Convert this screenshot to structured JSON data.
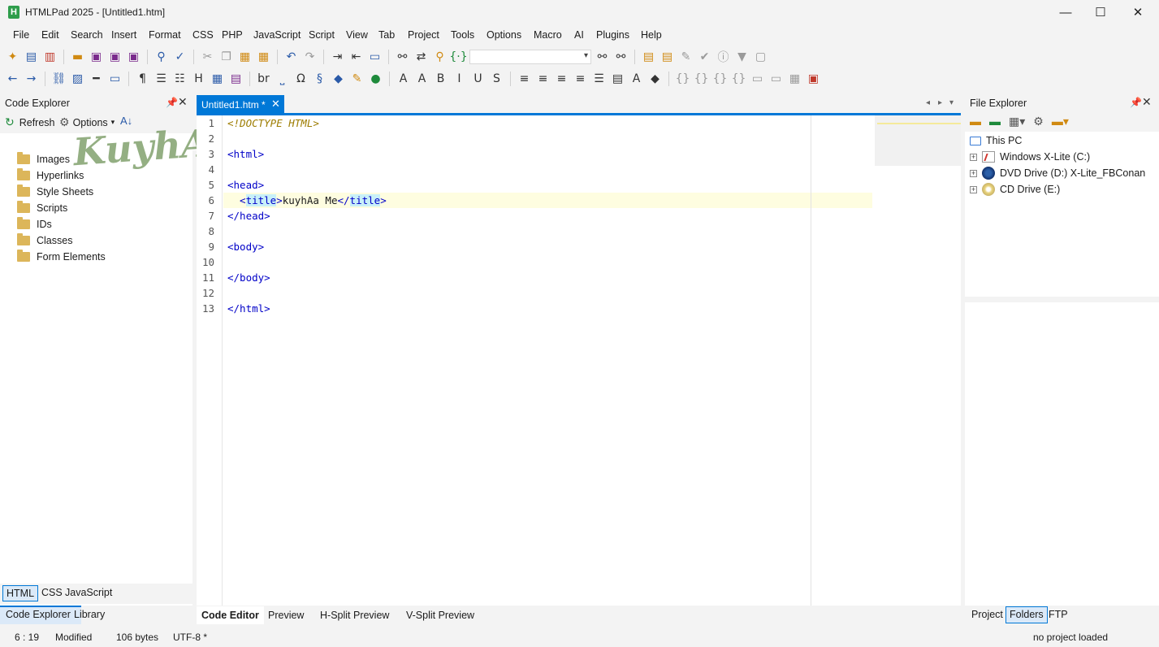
{
  "window": {
    "title": "HTMLPad 2025 - [Untitled1.htm]",
    "app_icon": "H",
    "controls": {
      "minimize": "—",
      "maximize": "☐",
      "close": "✕"
    }
  },
  "menu": [
    "File",
    "Edit",
    "Search",
    "Insert",
    "Format",
    "CSS",
    "PHP",
    "JavaScript",
    "Script",
    "View",
    "Tab",
    "Project",
    "Tools",
    "Options",
    "Macro",
    "AI",
    "Plugins",
    "Help"
  ],
  "code_explorer": {
    "title": "Code Explorer",
    "refresh_label": "Refresh",
    "options_label": "Options",
    "items": [
      "Images",
      "Hyperlinks",
      "Style Sheets",
      "Scripts",
      "IDs",
      "Classes",
      "Form Elements"
    ],
    "lang_tabs": [
      "HTML",
      "CSS",
      "JavaScript"
    ],
    "bottom_tabs": [
      "Code Explorer",
      "Library"
    ]
  },
  "editor": {
    "tab_label": "Untitled1.htm *",
    "lines": [
      {
        "n": "1",
        "html": "<span class='doct'>&lt;!DOCTYPE HTML&gt;</span>"
      },
      {
        "n": "2",
        "html": ""
      },
      {
        "n": "3",
        "html": "&lt;html&gt;"
      },
      {
        "n": "4",
        "html": ""
      },
      {
        "n": "5",
        "html": "&lt;head&gt;"
      },
      {
        "n": "6",
        "html": "  &lt;<span class='tname'>title</span>&gt;<span style='color:#1b1b1b'>kuyhAa Me</span>&lt;/<span class='tname'>title</span>&gt;"
      },
      {
        "n": "7",
        "html": "&lt;/head&gt;"
      },
      {
        "n": "8",
        "html": ""
      },
      {
        "n": "9",
        "html": "&lt;body&gt;"
      },
      {
        "n": "10",
        "html": ""
      },
      {
        "n": "11",
        "html": "&lt;/body&gt;"
      },
      {
        "n": "12",
        "html": ""
      },
      {
        "n": "13",
        "html": "&lt;/html&gt;"
      }
    ],
    "bottom_tabs": [
      "Code Editor",
      "Preview",
      "H-Split Preview",
      "V-Split Preview"
    ]
  },
  "file_explorer": {
    "title": "File Explorer",
    "root": "This PC",
    "drives": [
      "Windows X-Lite (C:)",
      "DVD Drive (D:) X-Lite_FBConan",
      "CD Drive (E:)"
    ],
    "bottom_tabs": [
      "Project",
      "Folders",
      "FTP"
    ]
  },
  "status": {
    "position": "6 : 19",
    "state": "Modified",
    "size": "106 bytes",
    "encoding": "UTF-8 *",
    "project": "no project loaded"
  },
  "watermark": "KuyhAa.Me",
  "colors": {
    "accent": "#0078d7",
    "tab_active": "#0078d7",
    "highlight_line": "#fefde0"
  }
}
